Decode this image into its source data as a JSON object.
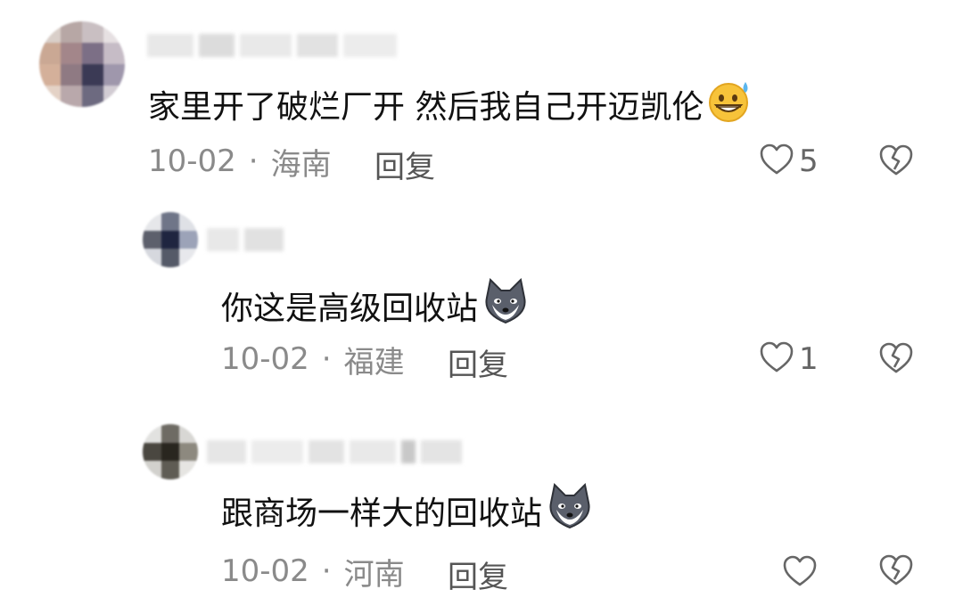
{
  "comments": [
    {
      "text": "家里开了破烂厂开 然后我自己开迈凯伦",
      "emoji": "sweat-grin-emoji",
      "date": "10-02",
      "separator": "·",
      "location": "海南",
      "reply_label": "回复",
      "like_count": "5"
    },
    {
      "text": "你这是高级回收站",
      "emoji": "husky-dog-emoji",
      "date": "10-02",
      "separator": "·",
      "location": "福建",
      "reply_label": "回复",
      "like_count": "1"
    },
    {
      "text": "跟商场一样大的回收站",
      "emoji": "husky-dog-emoji",
      "date": "10-02",
      "separator": "·",
      "location": "河南",
      "reply_label": "回复",
      "like_count": ""
    }
  ],
  "colors": {
    "meta_text": "#8a8a8a",
    "icon_stroke": "#666666",
    "body_text": "#111111"
  }
}
